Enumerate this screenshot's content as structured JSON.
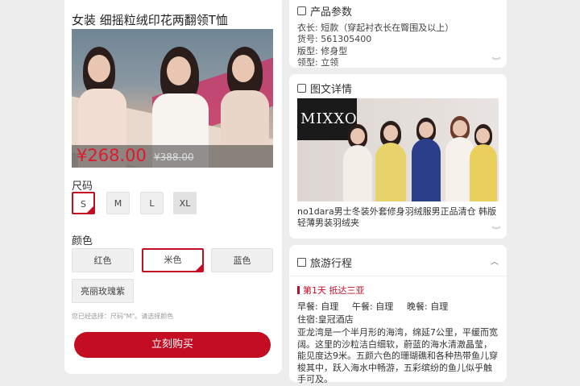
{
  "product": {
    "title": "女装 细摇粒绒印花两翻领T恤",
    "price": "¥268.00",
    "old_price": "¥388.00",
    "size_label": "尺码",
    "sizes": [
      "S",
      "M",
      "L",
      "XL"
    ],
    "selected_size": "S",
    "color_label": "颜色",
    "colors": [
      "红色",
      "米色",
      "蓝色",
      "亮丽玫瑰紫"
    ],
    "selected_color": "米色",
    "hint": "您已经选择：尺码\"M\"。请选择颜色",
    "buy_label": "立刻购买"
  },
  "params": {
    "title": "产品参数",
    "lines": [
      "衣长: 短款（穿起衬衣长在臀围及以上）",
      "货号: 561305400",
      "版型: 修身型",
      "领型: 立领"
    ]
  },
  "detail": {
    "title": "图文详情",
    "banner_brand": "MIXXO",
    "description": "no1dara男士冬装外套修身羽绒服男正品清仓 韩版轻薄男装羽绒夹"
  },
  "itinerary": {
    "title": "旅游行程",
    "day": "第1天 抵达三亚",
    "meals": [
      "早餐: 自理",
      "午餐: 自理",
      "晚餐: 自理"
    ],
    "hotel": "住宿:皇冠酒店",
    "paragraph": "亚龙湾是一个半月形的海湾，绵延7公里，平缓而宽阔。这里的沙粒洁白细软，蔚蓝的海水清澈晶莹，能见度达9米。五颜六色的珊瑚礁和各种热带鱼儿穿梭其中，跃入海水中畅游，五彩缤纷的鱼儿似乎触手可及。"
  },
  "colors": {
    "accent": "#c30d23",
    "background": "#ededed"
  }
}
